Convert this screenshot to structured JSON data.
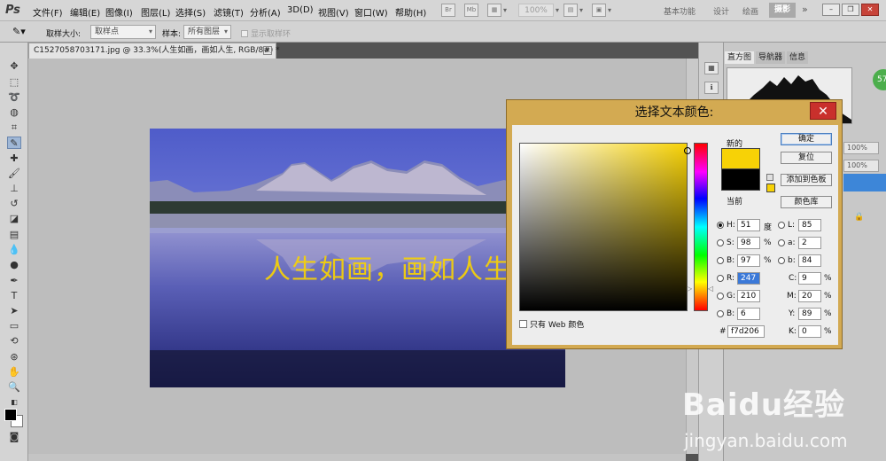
{
  "app": {
    "logo": "Ps"
  },
  "menu": [
    "文件(F)",
    "编辑(E)",
    "图像(I)",
    "图层(L)",
    "选择(S)",
    "滤镜(T)",
    "分析(A)",
    "3D(D)",
    "视图(V)",
    "窗口(W)",
    "帮助(H)"
  ],
  "menubar": {
    "icon_br": "Br",
    "icon_mb": "Mb",
    "zoom": "100%",
    "workspaces": [
      "基本功能",
      "设计",
      "绘画"
    ],
    "active_workspace": "摄影",
    "more": "»",
    "win_min": "–",
    "win_restore": "❐",
    "win_close": "✕"
  },
  "options": {
    "sample_size_label": "取样大小:",
    "sample_size_value": "取样点",
    "sample_label": "样本:",
    "sample_value": "所有图层",
    "show_ring": "显示取样环"
  },
  "document": {
    "tab_title": "C1527058703171.jpg @ 33.3%(人生如画，画如人生, RGB/8#) *",
    "tab_close": "×",
    "photo_text": "人生如画，画如人生"
  },
  "panels": {
    "tabs": [
      "直方图",
      "导航器",
      "信息"
    ],
    "pct_1": "100%",
    "pct_2": "100%",
    "badge": "57"
  },
  "dialog": {
    "title": "选择文本颜色:",
    "close": "✕",
    "new_label": "新的",
    "current_label": "当前",
    "buttons": {
      "ok": "确定",
      "reset": "复位",
      "add_swatch": "添加到色板",
      "libraries": "颜色库"
    },
    "web_only": "只有 Web 颜色",
    "fields": {
      "H": "51",
      "S": "98",
      "B": "97",
      "R": "247",
      "G": "210",
      "Bb": "6",
      "L": "85",
      "a": "2",
      "b": "84",
      "C": "9",
      "M": "20",
      "Y": "89",
      "K": "0"
    },
    "labels": {
      "H": "H:",
      "S": "S:",
      "B": "B:",
      "R": "R:",
      "G": "G:",
      "Bb": "B:",
      "L": "L:",
      "a": "a:",
      "b": "b:",
      "C": "C:",
      "M": "M:",
      "Y": "Y:",
      "K": "K:"
    },
    "units": {
      "deg": "度",
      "pct": "%"
    },
    "hex_label": "#",
    "hex": "f7d206",
    "new_color": "#f7d206",
    "current_color": "#000000"
  },
  "watermark": {
    "logo": "Baidu经验",
    "url": "jingyan.baidu.com"
  }
}
